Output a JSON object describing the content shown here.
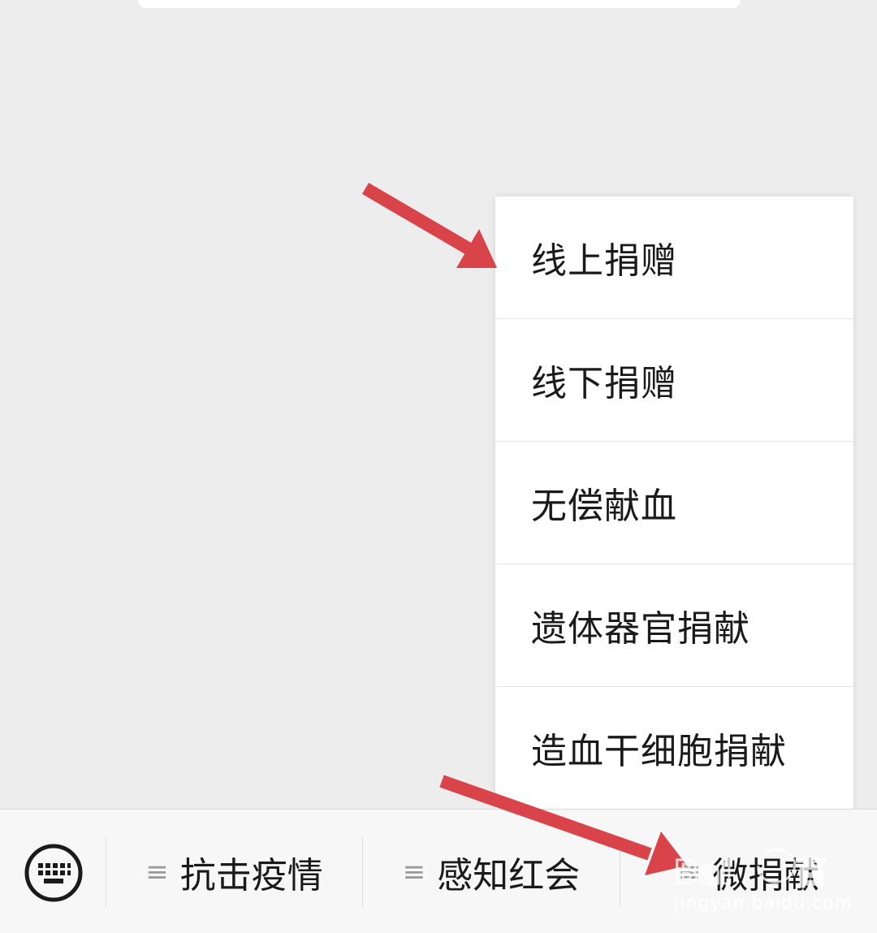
{
  "popup_menu": {
    "items": [
      {
        "label": "线上捐赠"
      },
      {
        "label": "线下捐赠"
      },
      {
        "label": "无偿献血"
      },
      {
        "label": "遗体器官捐献"
      },
      {
        "label": "造血干细胞捐献"
      }
    ]
  },
  "bottom_bar": {
    "keyboard_icon": "keyboard-icon",
    "menus": [
      {
        "label": "抗击疫情",
        "icon": "menu-lines-icon"
      },
      {
        "label": "感知红会",
        "icon": "menu-lines-icon"
      },
      {
        "label": "微捐献",
        "icon": "menu-lines-icon"
      }
    ]
  },
  "watermark": {
    "text": "jingyan.baidu.com"
  },
  "colors": {
    "background": "#ededed",
    "arrow": "#d9444b",
    "menu_bg": "#ffffff"
  }
}
